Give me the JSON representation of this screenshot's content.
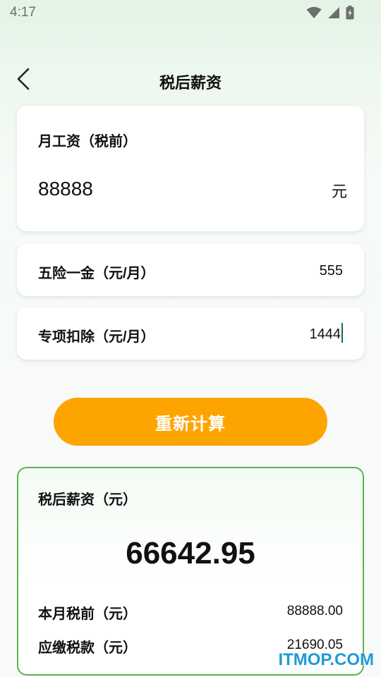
{
  "status_bar": {
    "time": "4:17",
    "icons": [
      "wifi-icon",
      "signal-icon",
      "battery-icon"
    ]
  },
  "nav": {
    "title": "税后薪资",
    "back_icon": "chevron-left-icon"
  },
  "salary_card": {
    "label": "月工资（税前）",
    "value": "88888",
    "unit": "元"
  },
  "insurance_card": {
    "label": "五险一金（元/月）",
    "value": "555"
  },
  "deduction_card": {
    "label": "专项扣除（元/月）",
    "value": "1444"
  },
  "action": {
    "recalculate_label": "重新计算"
  },
  "result": {
    "label": "税后薪资（元）",
    "amount": "66642.95",
    "rows": [
      {
        "label": "本月税前（元）",
        "value": "88888.00"
      },
      {
        "label": "应缴税款（元）",
        "value": "21690.05"
      }
    ]
  },
  "watermark": "ITMOP.COM",
  "colors": {
    "accent_orange": "#fea400",
    "result_border": "#5ab34a",
    "watermark": "#1e9bd8"
  }
}
